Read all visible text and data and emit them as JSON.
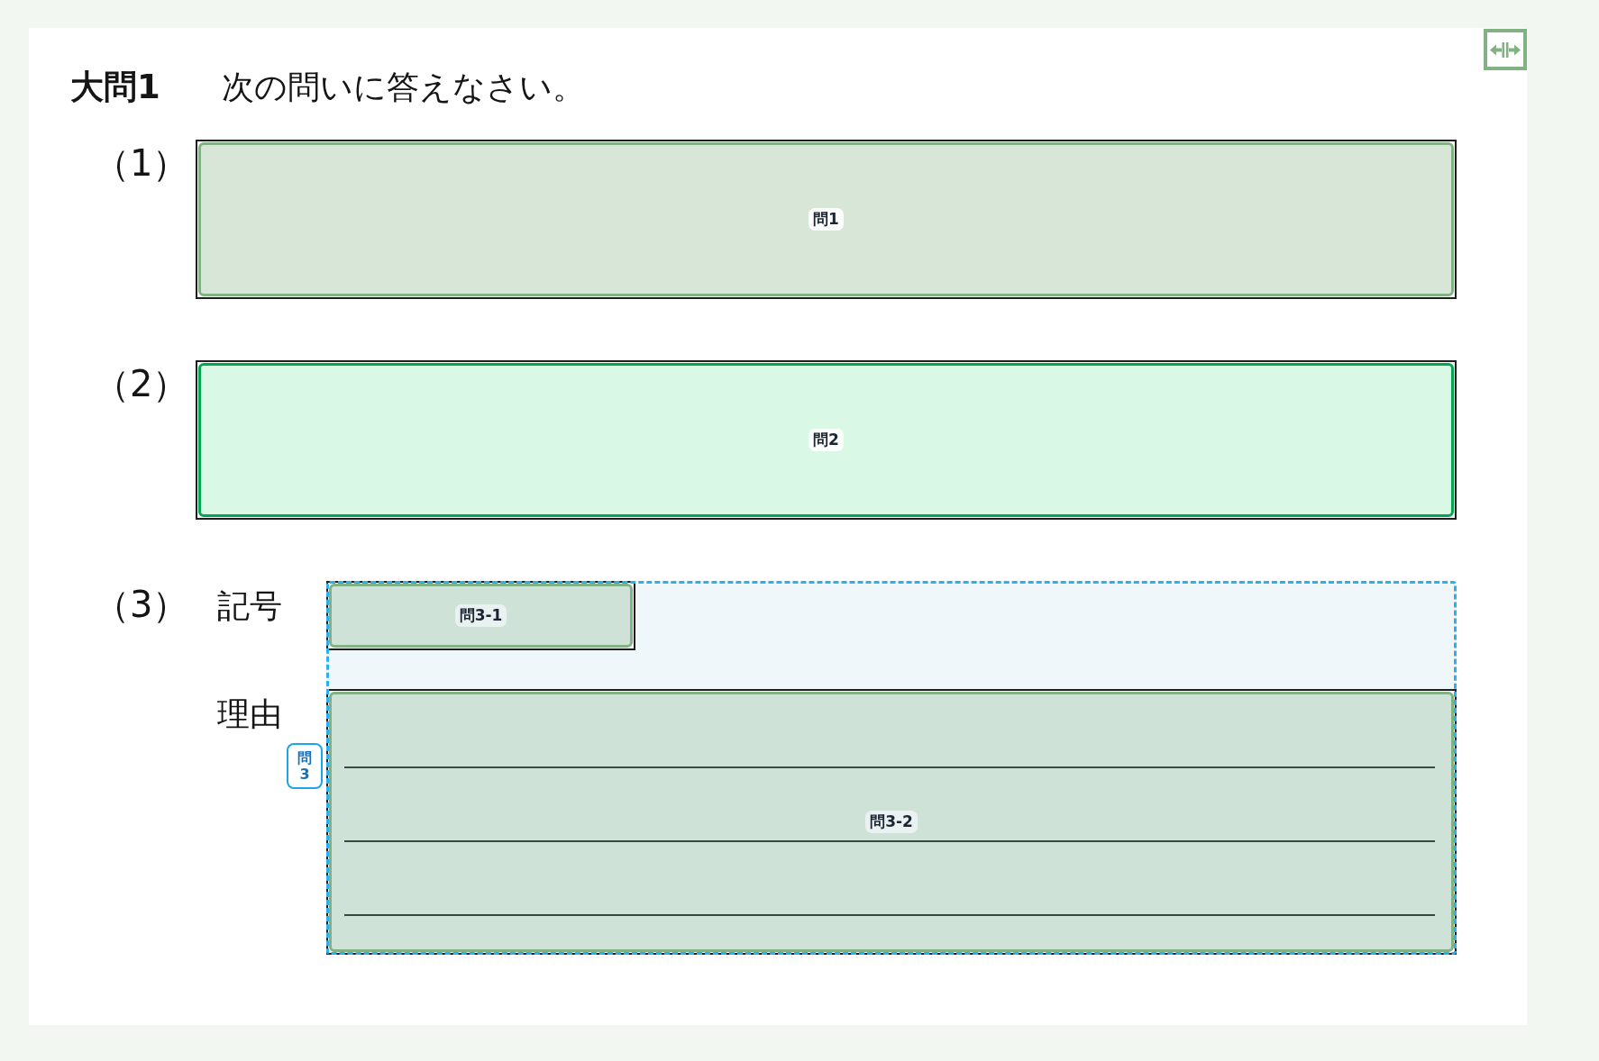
{
  "heading": {
    "number": "大問1",
    "instruction": "次の問いに答えなさい。"
  },
  "questions": [
    {
      "kind": "single",
      "number": "（1）",
      "answer": {
        "kind": "plain",
        "label": "問1",
        "selected": false
      }
    },
    {
      "kind": "single",
      "number": "（2）",
      "answer": {
        "kind": "plain",
        "label": "問2",
        "selected": true
      }
    },
    {
      "kind": "group",
      "number": "（3）",
      "group_label": "問3",
      "parts": [
        {
          "prompt": "記号",
          "answer": {
            "kind": "plain",
            "label": "問3-1",
            "selected": false
          }
        },
        {
          "prompt": "理由",
          "answer": {
            "kind": "ruled",
            "label": "問3-2",
            "selected": false
          }
        }
      ]
    }
  ]
}
